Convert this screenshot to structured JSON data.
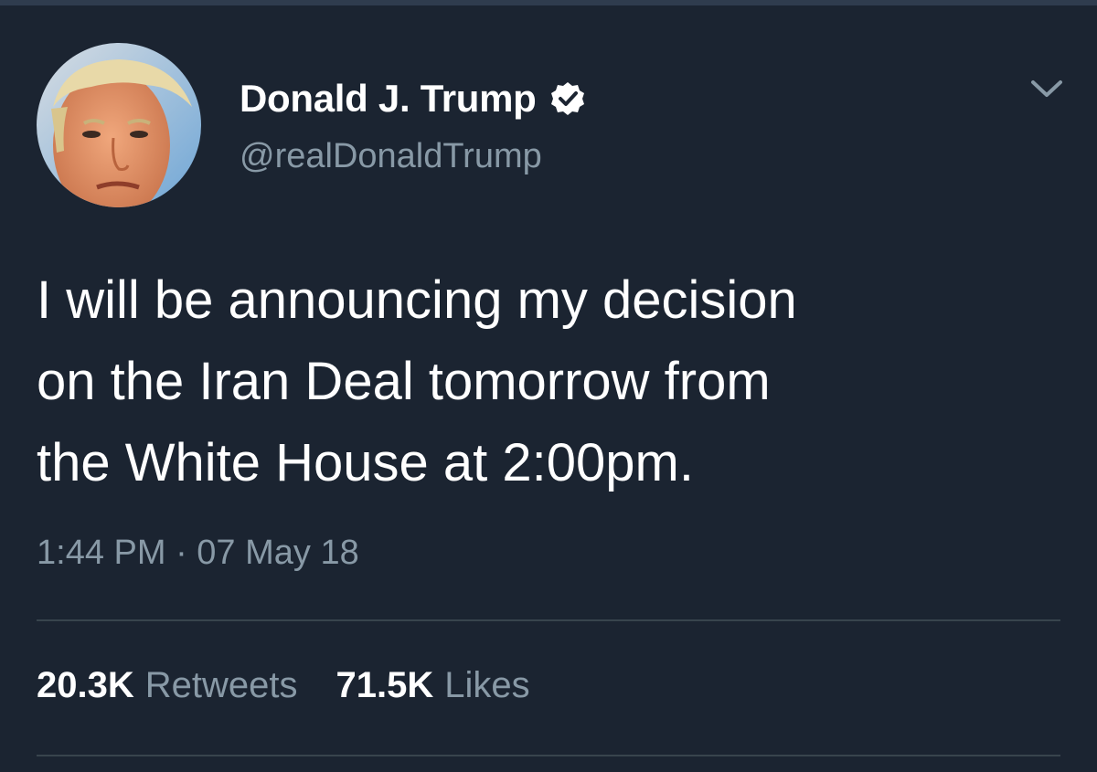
{
  "author": {
    "display_name": "Donald J. Trump",
    "handle": "@realDonaldTrump",
    "verified": true
  },
  "tweet": {
    "text_lines": [
      "I will be announcing my decision",
      "on the Iran Deal tomorrow from",
      "the White House at 2:00pm."
    ],
    "timestamp": "1:44 PM · 07 May 18"
  },
  "stats": {
    "retweets_count": "20.3K",
    "retweets_label": "Retweets",
    "likes_count": "71.5K",
    "likes_label": "Likes"
  },
  "icons": {
    "verified": "verified-badge-icon",
    "caret": "chevron-down-icon"
  },
  "colors": {
    "background": "#1b2431",
    "primary_text": "#ffffff",
    "secondary_text": "#8899a6",
    "divider": "#38444d"
  }
}
